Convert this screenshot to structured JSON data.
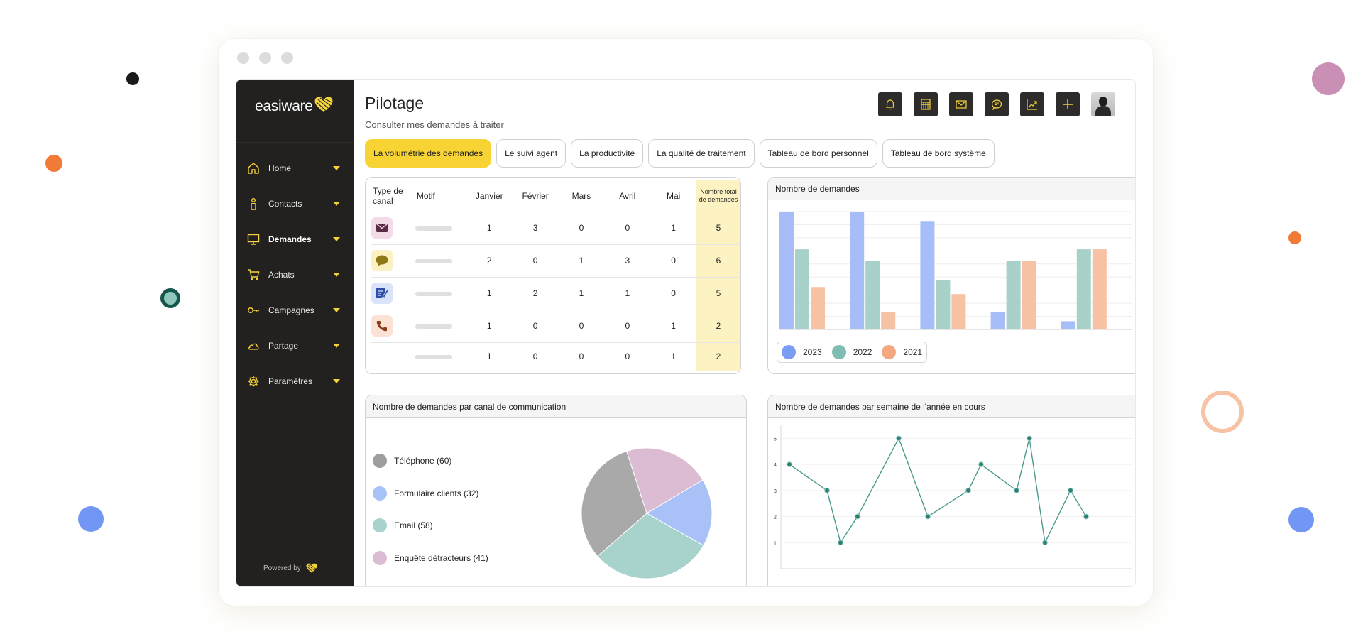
{
  "decorations": {
    "colors": [
      "#1a1a1a",
      "#f07a36",
      "#16574d",
      "#7296f3",
      "#c98fb5",
      "#f07a36",
      "#f7c3a5",
      "#7296f3"
    ]
  },
  "sidebar": {
    "logo_text": "easiware",
    "items": [
      {
        "label": "Home",
        "icon": "home-icon"
      },
      {
        "label": "Contacts",
        "icon": "person-icon"
      },
      {
        "label": "Demandes",
        "icon": "monitor-icon"
      },
      {
        "label": "Achats",
        "icon": "cart-icon"
      },
      {
        "label": "Campagnes",
        "icon": "key-icon"
      },
      {
        "label": "Partage",
        "icon": "cloud-icon"
      },
      {
        "label": "Paramètres",
        "icon": "gear-icon"
      }
    ],
    "powered_by": "Powered by"
  },
  "header": {
    "title": "Pilotage",
    "subtitle": "Consulter mes demandes à traiter",
    "toolbar_icons": [
      "bell-icon",
      "calculator-icon",
      "mail-icon",
      "chat-icon",
      "chart-icon",
      "plus-icon",
      "avatar"
    ]
  },
  "tabs": [
    {
      "label": "La volumétrie des demandes",
      "active": true
    },
    {
      "label": "Le suivi agent",
      "active": false
    },
    {
      "label": "La productivité",
      "active": false
    },
    {
      "label": "La qualité de traitement",
      "active": false
    },
    {
      "label": "Tableau de bord personnel",
      "active": false
    },
    {
      "label": "Tableau de bord système",
      "active": false
    }
  ],
  "volume_table": {
    "headers": [
      "Type de canal",
      "Motif",
      "Janvier",
      "Février",
      "Mars",
      "Avril",
      "Mai",
      "Nombre total de demandes"
    ],
    "rows": [
      {
        "channel_icon": "mail-icon",
        "values": [
          "1",
          "3",
          "0",
          "0",
          "1"
        ],
        "total": "5"
      },
      {
        "channel_icon": "chat-bubble-icon",
        "values": [
          "2",
          "0",
          "1",
          "3",
          "0"
        ],
        "total": "6"
      },
      {
        "channel_icon": "form-edit-icon",
        "values": [
          "1",
          "2",
          "1",
          "1",
          "0"
        ],
        "total": "5"
      },
      {
        "channel_icon": "phone-icon",
        "values": [
          "1",
          "0",
          "0",
          "0",
          "1"
        ],
        "total": "2"
      },
      {
        "channel_icon": "",
        "values": [
          "1",
          "0",
          "0",
          "0",
          "1"
        ],
        "total": "2"
      }
    ]
  },
  "bar_card": {
    "title": "Nombre de demandes",
    "legend": [
      {
        "label": "2023",
        "color": "#7b9cf4"
      },
      {
        "label": "2022",
        "color": "#7fbdb3"
      },
      {
        "label": "2021",
        "color": "#f5a77f"
      }
    ]
  },
  "pie_card": {
    "title": "Nombre de demandes par canal de communication",
    "legend": [
      {
        "label": "Téléphone (60)",
        "color": "#9e9e9e"
      },
      {
        "label": "Formulaire clients (32)",
        "color": "#a8c2f8"
      },
      {
        "label": "Email (58)",
        "color": "#a8d2cc"
      },
      {
        "label": "Enquête détracteurs (41)",
        "color": "#dcbcd2"
      }
    ]
  },
  "line_card": {
    "title": "Nombre de demandes par semaine de l'année en cours"
  },
  "chart_data": [
    {
      "type": "bar",
      "categories": [
        "",
        "",
        "",
        "",
        ""
      ],
      "series": [
        {
          "name": "2023",
          "values": [
            100,
            100,
            92,
            15,
            7
          ]
        },
        {
          "name": "2022",
          "values": [
            68,
            58,
            42,
            58,
            68
          ]
        },
        {
          "name": "2021",
          "values": [
            36,
            15,
            30,
            58,
            68
          ]
        }
      ],
      "ylim": [
        0,
        100
      ],
      "colors": [
        "#a6bdf8",
        "#a7d1c9",
        "#f7c1a3"
      ]
    },
    {
      "type": "pie",
      "labels": [
        "Téléphone",
        "Formulaire clients",
        "Email",
        "Enquête détracteurs"
      ],
      "values": [
        60,
        32,
        58,
        41
      ],
      "colors": [
        "#a9a9a9",
        "#a8c2f8",
        "#a8d2cc",
        "#dcbcd2"
      ]
    },
    {
      "type": "line",
      "yticks": [
        "1",
        "2",
        "3",
        "4",
        "5"
      ],
      "ylim": [
        0,
        5.5
      ],
      "values": [
        4,
        3,
        1,
        2,
        5,
        2,
        3,
        4,
        3,
        5,
        1,
        3,
        2
      ],
      "color": "#4a9a8e"
    }
  ]
}
